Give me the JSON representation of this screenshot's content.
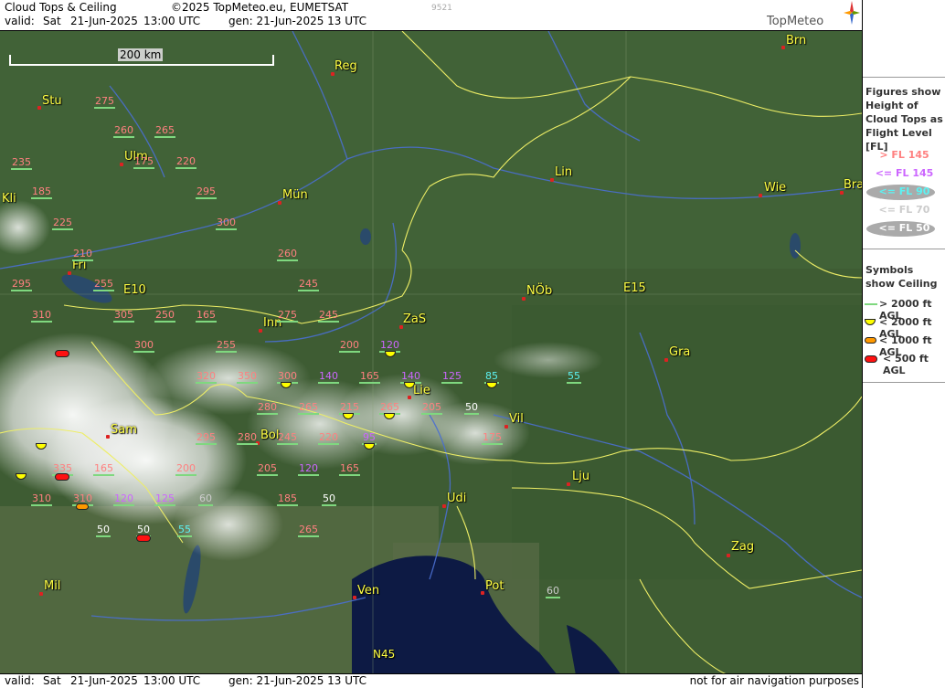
{
  "header": {
    "title": "Cloud Tops & Ceiling",
    "copyright": "©2025 TopMeteo.eu, EUMETSAT",
    "valid_label": "valid:",
    "valid_day": "Sat",
    "valid_date": "21-Jun-2025",
    "valid_time": "13:00 UTC",
    "gen_label": "gen: 21-Jun-2025 13 UTC",
    "image_code": "9521",
    "logo_text": "TopMeteo"
  },
  "scale": {
    "label": "200 km"
  },
  "footer": {
    "valid_label": "valid:",
    "valid_day": "Sat",
    "valid_date": "21-Jun-2025",
    "valid_time": "13:00 UTC",
    "gen_label": "gen: 21-Jun-2025 13 UTC",
    "disclaimer": "not for air navigation purposes"
  },
  "legend": {
    "figures_title": "Figures show Height of Cloud Tops as Flight Level [FL]",
    "fl_entries": [
      {
        "label": "> FL 145",
        "color": "#ff8080",
        "bg": "none"
      },
      {
        "label": "<= FL 145",
        "color": "#cc66ff",
        "bg": "none"
      },
      {
        "label": "<= FL 90",
        "color": "#5cf2f2",
        "bg": "#aaaaaa"
      },
      {
        "label": "<= FL 70",
        "color": "#cccccc",
        "bg": "none"
      },
      {
        "label": "<= FL 50",
        "color": "#ffffff",
        "bg": "#aaaaaa"
      }
    ],
    "symbols_title": "Symbols show Ceiling",
    "symbol_entries": [
      {
        "label": "> 2000 ft AGL",
        "kind": "line",
        "color": "#7fd87f"
      },
      {
        "label": "< 2000 ft AGL",
        "kind": "half",
        "color": "#ffff00"
      },
      {
        "label": "< 1000 ft AGL",
        "kind": "pill",
        "color": "#ff9900"
      },
      {
        "label": "< 500 ft AGL",
        "kind": "pill",
        "color": "#ff1111"
      }
    ]
  },
  "cities": [
    {
      "name": "Brn"
    },
    {
      "name": "Reg"
    },
    {
      "name": "Stu"
    },
    {
      "name": "Ulm"
    },
    {
      "name": "Kli"
    },
    {
      "name": "Mün"
    },
    {
      "name": "Lin"
    },
    {
      "name": "Wie"
    },
    {
      "name": "Bra"
    },
    {
      "name": "Fri"
    },
    {
      "name": "E10"
    },
    {
      "name": "Inn"
    },
    {
      "name": "ZaS"
    },
    {
      "name": "NÖb"
    },
    {
      "name": "E15"
    },
    {
      "name": "Gra"
    },
    {
      "name": "Lie"
    },
    {
      "name": "Vil"
    },
    {
      "name": "Sam"
    },
    {
      "name": "Bol"
    },
    {
      "name": "Lju"
    },
    {
      "name": "Udi"
    },
    {
      "name": "Zag"
    },
    {
      "name": "Mil"
    },
    {
      "name": "Ven"
    },
    {
      "name": "Pot"
    },
    {
      "name": "N45"
    }
  ],
  "flight_levels": [
    {
      "v": "275",
      "c": "hi"
    },
    {
      "v": "260",
      "c": "hi"
    },
    {
      "v": "265",
      "c": "hi"
    },
    {
      "v": "235",
      "c": "hi"
    },
    {
      "v": "175",
      "c": "hi"
    },
    {
      "v": "220",
      "c": "hi"
    },
    {
      "v": "185",
      "c": "hi"
    },
    {
      "v": "295",
      "c": "hi"
    },
    {
      "v": "225",
      "c": "hi"
    },
    {
      "v": "300",
      "c": "hi"
    },
    {
      "v": "210",
      "c": "hi"
    },
    {
      "v": "260",
      "c": "hi"
    },
    {
      "v": "295",
      "c": "hi"
    },
    {
      "v": "255",
      "c": "hi"
    },
    {
      "v": "245",
      "c": "hi"
    },
    {
      "v": "310",
      "c": "hi"
    },
    {
      "v": "305",
      "c": "hi"
    },
    {
      "v": "250",
      "c": "hi"
    },
    {
      "v": "165",
      "c": "hi"
    },
    {
      "v": "275",
      "c": "hi"
    },
    {
      "v": "245",
      "c": "hi"
    },
    {
      "v": "300",
      "c": "hi"
    },
    {
      "v": "255",
      "c": "hi"
    },
    {
      "v": "200",
      "c": "hi"
    },
    {
      "v": "120",
      "c": "mid"
    },
    {
      "v": "320",
      "c": "hi"
    },
    {
      "v": "350",
      "c": "hi"
    },
    {
      "v": "300",
      "c": "hi"
    },
    {
      "v": "140",
      "c": "mid"
    },
    {
      "v": "165",
      "c": "hi"
    },
    {
      "v": "140",
      "c": "mid"
    },
    {
      "v": "125",
      "c": "mid"
    },
    {
      "v": "85",
      "c": "lo"
    },
    {
      "v": "55",
      "c": "lo"
    },
    {
      "v": "280",
      "c": "hi"
    },
    {
      "v": "265",
      "c": "hi"
    },
    {
      "v": "215",
      "c": "hi"
    },
    {
      "v": "265",
      "c": "hi"
    },
    {
      "v": "205",
      "c": "hi"
    },
    {
      "v": "50",
      "c": "50"
    },
    {
      "v": "280",
      "c": "hi"
    },
    {
      "v": "245",
      "c": "hi"
    },
    {
      "v": "220",
      "c": "hi"
    },
    {
      "v": "95",
      "c": "mid"
    },
    {
      "v": "175",
      "c": "hi"
    },
    {
      "v": "295",
      "c": "hi"
    },
    {
      "v": "205",
      "c": "hi"
    },
    {
      "v": "120",
      "c": "mid"
    },
    {
      "v": "165",
      "c": "hi"
    },
    {
      "v": "335",
      "c": "hi"
    },
    {
      "v": "165",
      "c": "hi"
    },
    {
      "v": "310",
      "c": "hi"
    },
    {
      "v": "310",
      "c": "hi"
    },
    {
      "v": "120",
      "c": "mid"
    },
    {
      "v": "125",
      "c": "mid"
    },
    {
      "v": "60",
      "c": "70"
    },
    {
      "v": "185",
      "c": "hi"
    },
    {
      "v": "50",
      "c": "50"
    },
    {
      "v": "50",
      "c": "50"
    },
    {
      "v": "50",
      "c": "50"
    },
    {
      "v": "55",
      "c": "lo"
    },
    {
      "v": "265",
      "c": "hi"
    },
    {
      "v": "60",
      "c": "70"
    },
    {
      "v": "200",
      "c": "hi"
    }
  ],
  "ceiling_symbols": [
    {
      "kind": "y"
    },
    {
      "kind": "y"
    },
    {
      "kind": "y"
    },
    {
      "kind": "y"
    },
    {
      "kind": "y"
    },
    {
      "kind": "y"
    },
    {
      "kind": "y"
    },
    {
      "kind": "y"
    },
    {
      "kind": "y"
    },
    {
      "kind": "r"
    },
    {
      "kind": "r"
    },
    {
      "kind": "o"
    },
    {
      "kind": "r"
    },
    {
      "kind": "y"
    }
  ]
}
